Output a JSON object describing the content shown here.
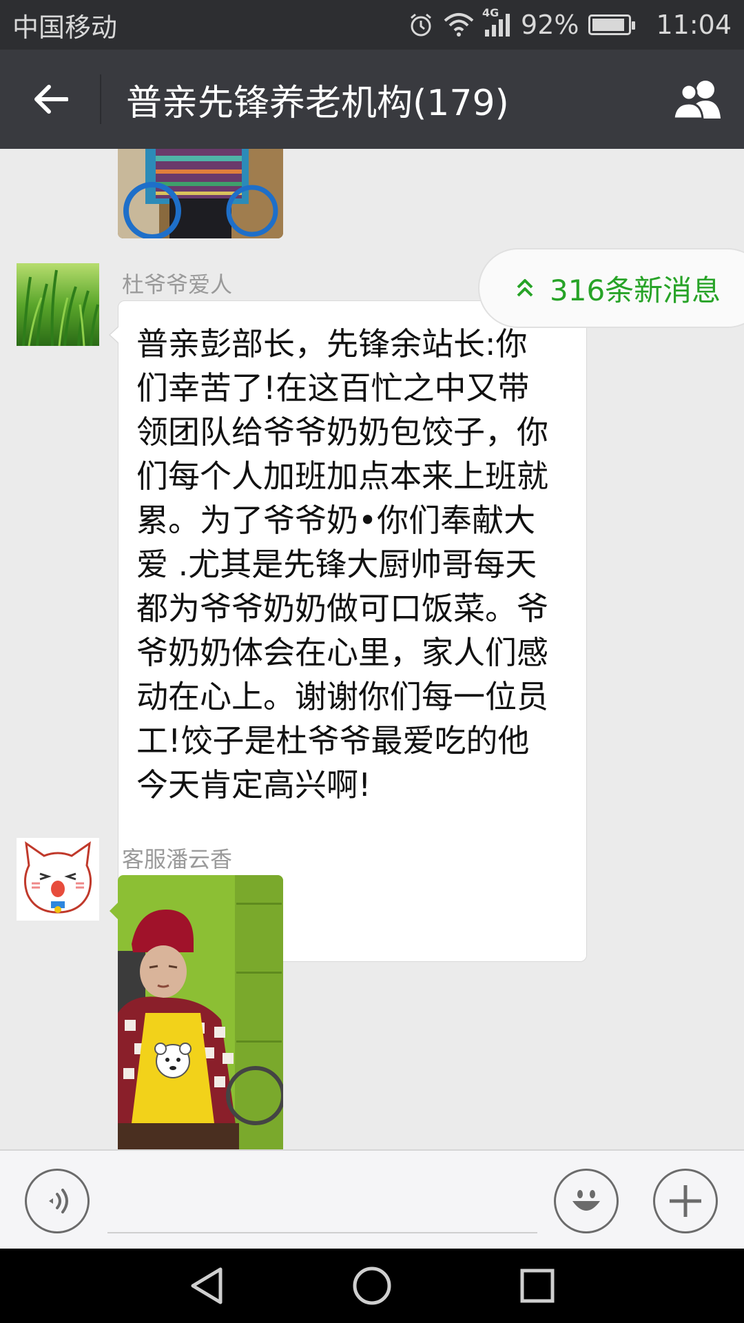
{
  "status_bar": {
    "carrier": "中国移动",
    "network": "4G",
    "battery": "92%",
    "battery_level": 0.92,
    "time": "11:04"
  },
  "header": {
    "title": "普亲先锋养老机构(179)",
    "back_icon": "arrow-left-icon",
    "members_icon": "group-members-icon"
  },
  "chat": {
    "new_messages": {
      "label": "316条新消息",
      "icon": "double-chevron-up-icon"
    },
    "messages": [
      {
        "type": "image",
        "description_hidden": true
      },
      {
        "type": "text",
        "sender": "杜爷爷爱人",
        "text": "普亲彭部长，先锋余站长:你\n们幸苦了!在这百忙之中又带\n领团队给爷爷奶奶包饺子，你\n们每个人加班加点本来上班就\n累。为了爷爷奶•你们奉献大\n爱 .尤其是先锋大厨帅哥每天\n都为爷爷奶奶做可口饭菜。爷\n爷奶奶体会在心里，家人们感\n动在心上。谢谢你们每一位员\n工!饺子是杜爷爷最爱吃的他\n今天肯定高兴啊!"
      },
      {
        "type": "image",
        "sender": "客服潘云香"
      }
    ]
  },
  "input_bar": {
    "voice_icon": "voice-icon",
    "emoji_icon": "emoji-icon",
    "plus_icon": "plus-icon"
  },
  "nav_bar": {
    "back_icon": "nav-back-icon",
    "home_icon": "nav-home-icon",
    "recents_icon": "nav-recents-icon"
  },
  "colors": {
    "header_bg": "#393a3f",
    "chat_bg": "#ebebeb",
    "accent_green": "#27a327"
  }
}
